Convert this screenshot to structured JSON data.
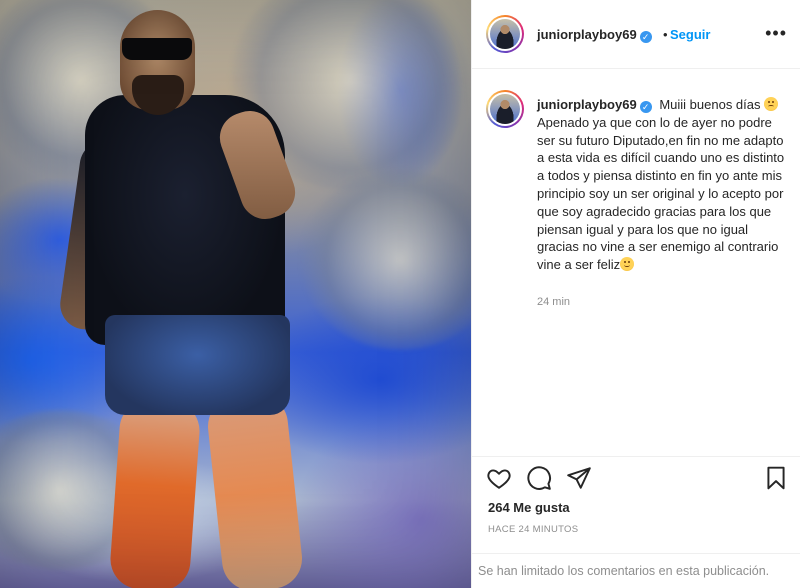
{
  "post": {
    "username": "juniorplayboy69",
    "verified_glyph": "✓",
    "separator": "•",
    "follow_label": "Seguir",
    "more_label": "•••",
    "caption": {
      "line_1": "Muiii buenos días",
      "line_2": "Apenado ya que con lo de ayer no podre ser su futuro Diputado,en fin no me adapto a esta vida es difícil cuando uno es distinto a todos y piensa distinto en fin yo ante mis principio soy un ser original y lo acepto por que soy agradecido gracias para los que piensan igual y para los que no igual gracias no vine a ser enemigo al contrario vine a ser feliz",
      "time": "24 min"
    },
    "likes": "264 Me gusta",
    "posted_time": "HACE 24 MINUTOS",
    "comments_notice": "Se han limitado los comentarios en esta publicación."
  },
  "icons": {
    "like": "heart-icon",
    "comment": "comment-bubble-icon",
    "share": "paper-plane-icon",
    "save": "bookmark-icon",
    "more": "more-options-icon",
    "verified": "verified-badge-icon",
    "sad_emoji": "sad-face-emoji",
    "smile_emoji": "smiling-face-emoji"
  },
  "colors": {
    "accent": "#0095f6",
    "verified": "#3897f0",
    "text": "#262626",
    "muted": "#8e8e8e",
    "divider": "#efefef"
  }
}
